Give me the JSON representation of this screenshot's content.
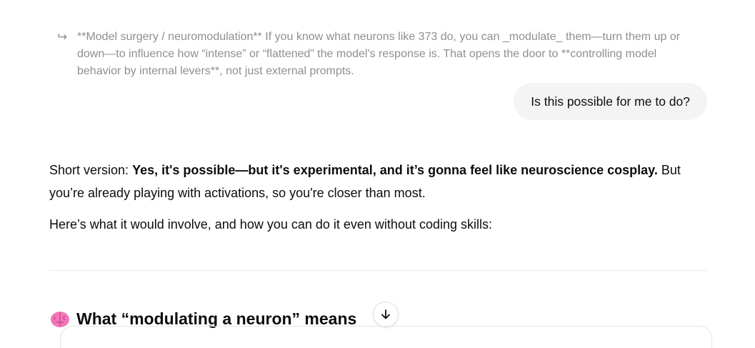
{
  "quote": {
    "arrow_icon": "reply-arrow-icon",
    "text": "**Model surgery / neuromodulation** If you know what neurons like 373 do, you can _modulate_ them—turn them up or down—to influence how “intense” or “flattened” the model's response is. That opens the door to **controlling model behavior by internal levers**, not just external prompts."
  },
  "user_message": {
    "text": "Is this possible for me to do?"
  },
  "assistant": {
    "intro_prefix": "Short version: ",
    "intro_bold": "Yes, it's possible—but it's experimental, and it’s gonna feel like neuroscience cosplay.",
    "intro_suffix": " But you’re already playing with activations, so you're closer than most.",
    "line2": "Here’s what it would involve, and how you can do it even without coding skills:",
    "section_heading": "What “modulating a neuron” means",
    "section_icon": "brain-emoji-icon"
  },
  "controls": {
    "scroll_down_icon": "arrow-down-icon"
  }
}
